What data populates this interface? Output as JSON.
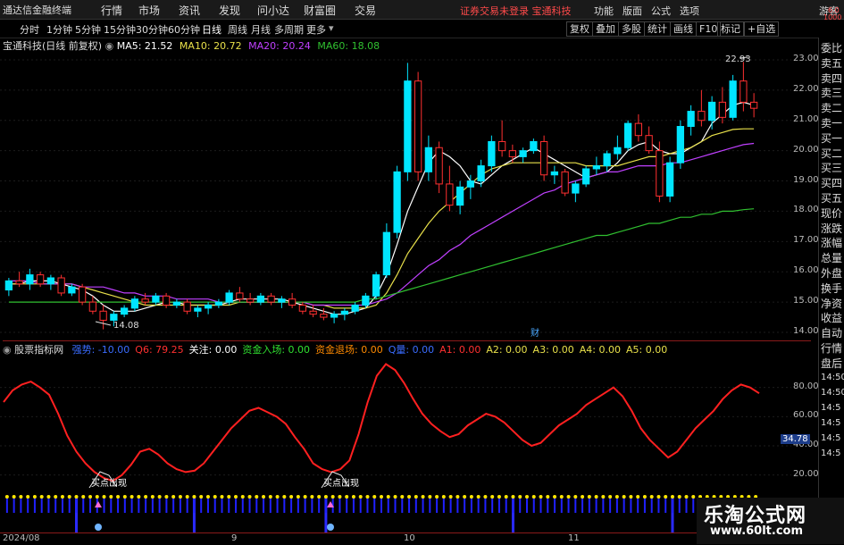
{
  "menubar": {
    "app_title": "通达信金融终端",
    "menus": [
      "行情",
      "市场",
      "资讯",
      "发现",
      "问小达",
      "财富圈",
      "交易"
    ],
    "notice": "证券交易未登录  宝通科技",
    "right": [
      "功能",
      "版面",
      "公式",
      "选项"
    ],
    "guest": "游客"
  },
  "periodbar": {
    "periods": [
      "分时",
      "1分钟",
      "5分钟",
      "15分钟",
      "30分钟",
      "60分钟",
      "日线",
      "周线",
      "月线",
      "多周期",
      "更多"
    ],
    "active": "日线",
    "tools": [
      "复权",
      "叠加",
      "多股",
      "统计",
      "画线",
      "F10",
      "标记",
      "+自选"
    ]
  },
  "main_chart": {
    "stock": "宝通科技(日线 前复权)",
    "ma5_label": "MA5: 21.52",
    "ma10_label": "MA10: 20.72",
    "ma20_label": "MA20: 20.24",
    "ma60_label": "MA60: 18.08",
    "high_label": "22.93",
    "low_label": "14.08",
    "event_marker": "财",
    "y_ticks": [
      "23.00",
      "22.00",
      "21.00",
      "20.00",
      "19.00",
      "18.00",
      "17.00",
      "16.00",
      "15.00",
      "14.00"
    ],
    "colors": {
      "up": "#00e5ff",
      "down": "#ff3030",
      "ma5": "#ffffff",
      "ma10": "#e8e04a",
      "ma20": "#c040ff",
      "ma60": "#30c030"
    }
  },
  "indicator": {
    "name": "股票指标网",
    "values": [
      {
        "label": "强势: -10.00",
        "color": "#3a6cff"
      },
      {
        "label": "Q6: 79.25",
        "color": "#ff3030"
      },
      {
        "label": "关注: 0.00",
        "color": "#ffffff"
      },
      {
        "label": "资金入场: 0.00",
        "color": "#30e030"
      },
      {
        "label": "资金退场: 0.00",
        "color": "#ff8a00"
      },
      {
        "label": "Q量: 0.00",
        "color": "#3a6cff"
      },
      {
        "label": "A1: 0.00",
        "color": "#ff3030"
      },
      {
        "label": "A2: 0.00",
        "color": "#e8e04a"
      },
      {
        "label": "A3: 0.00",
        "color": "#e8e04a"
      },
      {
        "label": "A4: 0.00",
        "color": "#e8e04a"
      },
      {
        "label": "A5: 0.00",
        "color": "#e8e04a"
      }
    ],
    "y_ticks": [
      "80.00",
      "60.00",
      "40.00",
      "20.00"
    ],
    "current_badge": "34.78",
    "annotations": [
      "买点出现",
      "买点出现"
    ]
  },
  "time_axis": [
    "2024/08",
    "9",
    "10",
    "11"
  ],
  "right_column": {
    "groups": [
      "委比",
      "卖五",
      "卖四",
      "卖三",
      "卖二",
      "卖一",
      "买一",
      "买二",
      "买三",
      "买四",
      "买五",
      "现价",
      "涨跌",
      "涨幅",
      "总量",
      "外盘",
      "换手",
      "净资",
      "收益",
      "自动",
      "行情",
      "盘后"
    ],
    "times": [
      "14:50",
      "14:50",
      "14:5",
      "14:5",
      "14:5",
      "14:5"
    ],
    "top_label": "6.0",
    "top_label2": "1000"
  },
  "watermark": {
    "title": "乐淘公式网",
    "url": "www.60lt.com"
  },
  "chart_data": [
    {
      "type": "candlestick",
      "title": "宝通科技(日线 前复权)",
      "ylim": [
        14.0,
        23.5
      ],
      "series": [
        {
          "name": "OHLC",
          "values": [
            [
              15.4,
              15.8,
              15.2,
              15.7
            ],
            [
              15.7,
              16.0,
              15.5,
              15.6
            ],
            [
              15.6,
              16.1,
              15.4,
              15.9
            ],
            [
              15.9,
              16.0,
              15.5,
              15.6
            ],
            [
              15.6,
              15.9,
              15.4,
              15.8
            ],
            [
              15.8,
              15.9,
              15.2,
              15.3
            ],
            [
              15.3,
              15.6,
              15.2,
              15.5
            ],
            [
              15.5,
              15.6,
              14.9,
              15.0
            ],
            [
              15.0,
              15.2,
              14.6,
              14.7
            ],
            [
              14.7,
              14.9,
              14.1,
              14.4
            ],
            [
              14.4,
              14.7,
              14.2,
              14.6
            ],
            [
              14.6,
              14.9,
              14.5,
              14.8
            ],
            [
              14.8,
              15.2,
              14.7,
              15.1
            ],
            [
              15.1,
              15.3,
              14.9,
              15.0
            ],
            [
              15.0,
              15.3,
              14.9,
              15.2
            ],
            [
              15.2,
              15.3,
              14.8,
              14.9
            ],
            [
              14.9,
              15.1,
              14.8,
              15.0
            ],
            [
              15.0,
              15.1,
              14.6,
              14.7
            ],
            [
              14.7,
              14.9,
              14.5,
              14.8
            ],
            [
              14.8,
              15.0,
              14.6,
              14.9
            ],
            [
              14.9,
              15.1,
              14.8,
              15.0
            ],
            [
              15.0,
              15.4,
              14.9,
              15.3
            ],
            [
              15.3,
              15.5,
              15.0,
              15.1
            ],
            [
              15.1,
              15.3,
              14.9,
              15.0
            ],
            [
              15.0,
              15.3,
              14.9,
              15.2
            ],
            [
              15.2,
              15.3,
              14.9,
              15.0
            ],
            [
              15.0,
              15.2,
              14.8,
              15.1
            ],
            [
              15.1,
              15.3,
              14.8,
              14.9
            ],
            [
              14.9,
              15.0,
              14.6,
              14.7
            ],
            [
              14.7,
              14.9,
              14.5,
              14.6
            ],
            [
              14.6,
              14.8,
              14.4,
              14.5
            ],
            [
              14.5,
              14.7,
              14.3,
              14.6
            ],
            [
              14.6,
              14.8,
              14.4,
              14.7
            ],
            [
              14.7,
              15.0,
              14.6,
              14.9
            ],
            [
              14.9,
              15.3,
              14.8,
              15.2
            ],
            [
              15.2,
              16.0,
              15.1,
              15.9
            ],
            [
              15.9,
              17.6,
              15.8,
              17.3
            ],
            [
              17.3,
              19.5,
              17.1,
              19.3
            ],
            [
              19.3,
              22.9,
              19.0,
              22.3
            ],
            [
              22.3,
              22.6,
              19.0,
              19.3
            ],
            [
              19.3,
              20.5,
              19.0,
              20.1
            ],
            [
              20.1,
              20.3,
              18.6,
              18.9
            ],
            [
              18.9,
              19.5,
              18.0,
              18.2
            ],
            [
              18.2,
              19.0,
              17.9,
              18.8
            ],
            [
              18.8,
              19.2,
              18.4,
              19.0
            ],
            [
              19.0,
              19.7,
              18.8,
              19.5
            ],
            [
              19.5,
              20.5,
              19.3,
              20.3
            ],
            [
              20.3,
              21.0,
              19.8,
              20.0
            ],
            [
              20.0,
              20.2,
              19.6,
              19.8
            ],
            [
              19.8,
              20.1,
              19.6,
              20.0
            ],
            [
              20.0,
              20.4,
              19.9,
              20.3
            ],
            [
              20.3,
              20.5,
              19.0,
              19.2
            ],
            [
              19.2,
              19.5,
              18.9,
              19.3
            ],
            [
              19.3,
              19.4,
              18.5,
              18.6
            ],
            [
              18.6,
              19.0,
              18.3,
              18.9
            ],
            [
              18.9,
              19.5,
              18.8,
              19.4
            ],
            [
              19.4,
              19.8,
              19.2,
              19.5
            ],
            [
              19.5,
              20.0,
              19.3,
              19.9
            ],
            [
              19.9,
              20.5,
              19.7,
              20.1
            ],
            [
              20.1,
              21.0,
              20.0,
              20.9
            ],
            [
              20.9,
              21.2,
              20.3,
              20.5
            ],
            [
              20.5,
              20.8,
              19.9,
              20.0
            ],
            [
              20.0,
              20.3,
              18.3,
              18.5
            ],
            [
              18.5,
              19.8,
              18.3,
              19.6
            ],
            [
              19.6,
              21.0,
              19.4,
              20.8
            ],
            [
              20.8,
              21.5,
              20.5,
              21.3
            ],
            [
              21.3,
              22.0,
              20.8,
              21.0
            ],
            [
              21.0,
              21.8,
              20.7,
              21.6
            ],
            [
              21.6,
              22.1,
              20.9,
              21.1
            ],
            [
              21.1,
              22.5,
              21.0,
              22.3
            ],
            [
              22.3,
              22.93,
              21.3,
              21.6
            ],
            [
              21.6,
              21.9,
              21.1,
              21.4
            ]
          ]
        },
        {
          "name": "MA5",
          "values": [
            15.6,
            15.6,
            15.7,
            15.7,
            15.7,
            15.6,
            15.5,
            15.4,
            15.2,
            14.9,
            14.7,
            14.7,
            14.7,
            14.8,
            14.9,
            15.0,
            15.0,
            14.9,
            14.9,
            14.9,
            14.9,
            15.0,
            15.1,
            15.1,
            15.1,
            15.1,
            15.1,
            15.0,
            14.9,
            14.8,
            14.7,
            14.6,
            14.6,
            14.7,
            14.8,
            15.2,
            15.9,
            16.9,
            18.0,
            18.8,
            19.6,
            20.0,
            19.8,
            19.5,
            19.0,
            18.9,
            19.2,
            19.5,
            19.7,
            19.9,
            20.1,
            19.9,
            19.7,
            19.5,
            19.3,
            19.1,
            19.2,
            19.3,
            19.6,
            20.0,
            20.2,
            20.3,
            20.0,
            19.9,
            19.9,
            20.1,
            20.3,
            20.9,
            21.2,
            21.5,
            21.6,
            21.5
          ]
        },
        {
          "name": "MA10",
          "values": [
            15.6,
            15.6,
            15.6,
            15.6,
            15.6,
            15.6,
            15.6,
            15.5,
            15.4,
            15.3,
            15.2,
            15.1,
            15.0,
            14.9,
            14.9,
            14.9,
            14.9,
            14.9,
            14.9,
            14.9,
            14.9,
            14.9,
            15.0,
            15.0,
            15.0,
            15.0,
            15.0,
            15.0,
            15.0,
            14.9,
            14.9,
            14.8,
            14.8,
            14.8,
            14.8,
            14.9,
            15.3,
            15.9,
            16.6,
            17.1,
            17.6,
            18.0,
            18.3,
            18.6,
            18.9,
            19.2,
            19.4,
            19.5,
            19.6,
            19.6,
            19.6,
            19.6,
            19.6,
            19.6,
            19.6,
            19.5,
            19.5,
            19.5,
            19.5,
            19.6,
            19.7,
            19.8,
            19.8,
            19.9,
            20.0,
            20.1,
            20.3,
            20.5,
            20.6,
            20.7,
            20.72,
            20.72
          ]
        },
        {
          "name": "MA20",
          "values": [
            15.7,
            15.7,
            15.7,
            15.6,
            15.6,
            15.6,
            15.6,
            15.5,
            15.5,
            15.5,
            15.4,
            15.3,
            15.3,
            15.2,
            15.2,
            15.2,
            15.1,
            15.1,
            15.1,
            15.1,
            15.0,
            15.0,
            15.0,
            15.0,
            15.0,
            15.0,
            15.0,
            15.0,
            15.0,
            14.9,
            14.9,
            14.9,
            14.9,
            14.9,
            14.9,
            15.0,
            15.1,
            15.3,
            15.6,
            15.9,
            16.2,
            16.4,
            16.7,
            16.9,
            17.2,
            17.4,
            17.6,
            17.8,
            18.0,
            18.2,
            18.4,
            18.6,
            18.7,
            18.9,
            19.0,
            19.1,
            19.2,
            19.3,
            19.3,
            19.4,
            19.5,
            19.5,
            19.5,
            19.6,
            19.6,
            19.7,
            19.8,
            19.9,
            20.0,
            20.1,
            20.2,
            20.24
          ]
        },
        {
          "name": "MA60",
          "values": [
            15.0,
            15.0,
            15.0,
            15.0,
            15.0,
            15.0,
            15.0,
            15.0,
            15.0,
            15.0,
            15.0,
            15.0,
            15.0,
            15.0,
            15.0,
            15.0,
            15.0,
            15.0,
            15.0,
            15.0,
            15.0,
            15.0,
            15.0,
            15.0,
            15.0,
            15.0,
            15.0,
            15.0,
            15.0,
            15.0,
            15.0,
            15.0,
            15.0,
            15.0,
            15.1,
            15.1,
            15.2,
            15.3,
            15.4,
            15.5,
            15.6,
            15.7,
            15.8,
            15.9,
            16.0,
            16.1,
            16.2,
            16.3,
            16.4,
            16.5,
            16.6,
            16.7,
            16.8,
            16.9,
            17.0,
            17.1,
            17.2,
            17.2,
            17.3,
            17.4,
            17.5,
            17.6,
            17.6,
            17.7,
            17.8,
            17.8,
            17.9,
            17.9,
            18.0,
            18.0,
            18.05,
            18.08
          ]
        }
      ]
    },
    {
      "type": "line",
      "title": "股票指标网",
      "ylim": [
        10,
        100
      ],
      "series": [
        {
          "name": "Q6",
          "values": [
            70,
            78,
            82,
            84,
            80,
            75,
            62,
            47,
            36,
            28,
            22,
            18,
            16,
            20,
            27,
            36,
            38,
            34,
            28,
            24,
            22,
            23,
            28,
            36,
            44,
            52,
            58,
            64,
            66,
            63,
            60,
            55,
            46,
            38,
            28,
            24,
            22,
            24,
            30,
            48,
            70,
            88,
            96,
            92,
            83,
            72,
            62,
            55,
            50,
            46,
            48,
            54,
            58,
            62,
            60,
            56,
            50,
            44,
            40,
            42,
            48,
            54,
            58,
            62,
            68,
            72,
            76,
            80,
            74,
            64,
            52,
            44,
            38,
            32,
            36,
            44,
            52,
            58,
            64,
            72,
            78,
            82,
            80,
            76
          ]
        },
        {
          "name": "强势",
          "values": [
            0,
            0,
            0,
            0,
            0,
            0,
            0,
            0,
            0,
            0,
            20,
            0,
            0,
            0,
            0,
            0,
            0,
            0,
            0,
            0,
            0,
            0,
            0,
            0,
            0,
            0,
            0,
            20,
            0,
            0,
            0,
            0,
            0,
            0,
            0,
            0,
            0,
            0,
            0,
            0,
            0,
            0,
            0,
            0,
            0,
            0,
            20,
            0,
            0,
            0,
            0,
            0,
            0,
            0,
            0,
            0,
            0,
            0,
            0,
            0,
            0,
            0,
            0,
            0,
            0,
            0,
            0,
            0,
            0,
            0,
            0,
            0,
            0,
            20,
            0,
            0,
            0,
            0,
            0,
            0,
            0,
            0,
            0,
            0,
            0,
            0,
            0,
            0,
            0,
            0,
            0,
            0,
            0,
            0,
            0,
            0,
            20,
            0,
            0,
            0,
            0,
            0,
            0,
            0,
            0,
            0,
            0,
            0,
            0
          ]
        }
      ]
    }
  ]
}
